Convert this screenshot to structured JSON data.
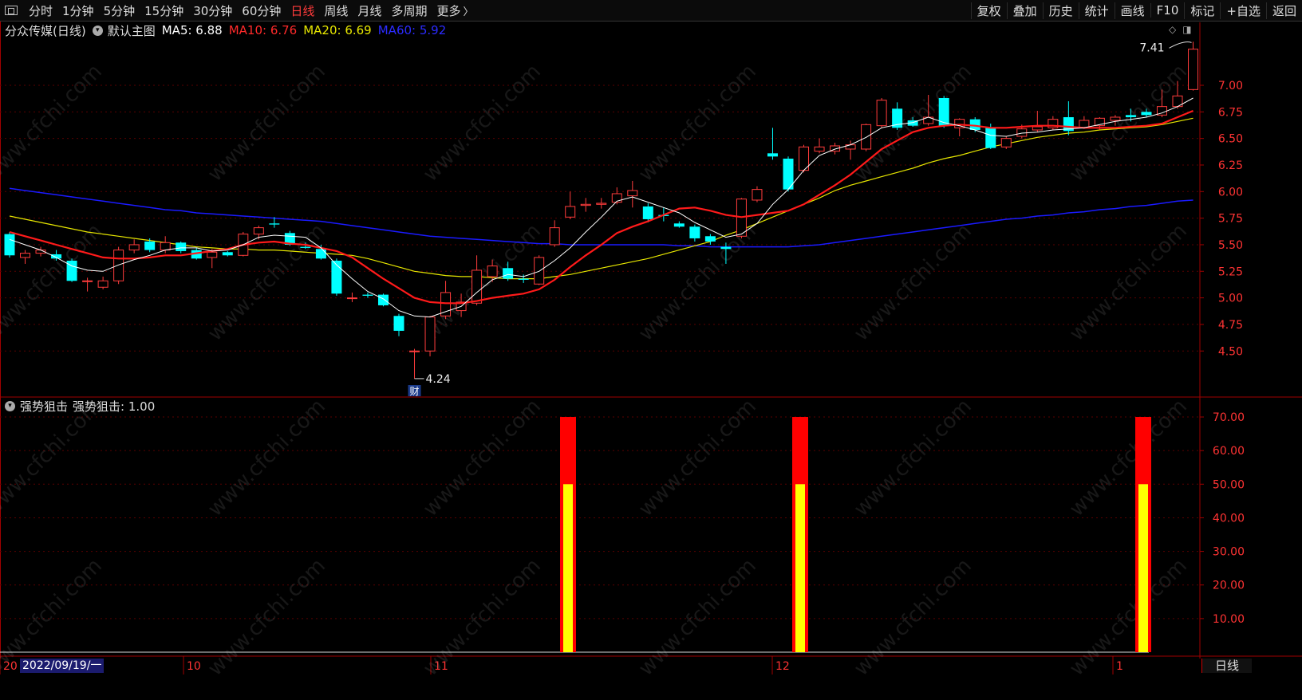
{
  "toolbar": {
    "left_items": [
      {
        "label": "分时",
        "active": false
      },
      {
        "label": "1分钟",
        "active": false
      },
      {
        "label": "5分钟",
        "active": false
      },
      {
        "label": "15分钟",
        "active": false
      },
      {
        "label": "30分钟",
        "active": false
      },
      {
        "label": "60分钟",
        "active": false
      },
      {
        "label": "日线",
        "active": true
      },
      {
        "label": "周线",
        "active": false
      },
      {
        "label": "月线",
        "active": false
      },
      {
        "label": "多周期",
        "active": false
      },
      {
        "label": "更多",
        "active": false
      }
    ],
    "more_chevron": "〉",
    "right_items": [
      "复权",
      "叠加",
      "历史",
      "统计",
      "画线",
      "F10",
      "标记",
      "+自选",
      "返回"
    ]
  },
  "main_legend": {
    "stock": "分众传媒(日线)",
    "template": "默认主图",
    "ma5": "MA5: 6.88",
    "ma10": "MA10: 6.76",
    "ma20": "MA20: 6.69",
    "ma60": "MA60: 5.92"
  },
  "sub_legend": {
    "name": "强势狙击",
    "value": "强势狙击: 1.00"
  },
  "annotations": {
    "high": "7.41",
    "low": "4.24",
    "finance_tag": "财"
  },
  "x_axis": {
    "date_badge": "2022/09/19/一",
    "month_labels": [
      "20",
      "10",
      "11",
      "12",
      "1"
    ]
  },
  "period_badge": "日线",
  "colors": {
    "up": "#ff3c3c",
    "down": "#00ffff",
    "ma5": "#ffffff",
    "ma10": "#ff1a1a",
    "ma20": "#e6e600",
    "ma60": "#1a1aff",
    "grid": "#8b0000",
    "axis_text": "#ff3333"
  },
  "chart_data": [
    {
      "type": "candlestick",
      "title": "分众传媒(日线)",
      "y_range": [
        4.24,
        7.41
      ],
      "y_ticks": [
        "7.00",
        "6.75",
        "6.50",
        "6.25",
        "6.00",
        "5.75",
        "5.50",
        "5.25",
        "5.00",
        "4.75",
        "4.50"
      ],
      "candles": [
        {
          "o": 5.6,
          "h": 5.62,
          "l": 5.38,
          "c": 5.4
        },
        {
          "o": 5.38,
          "h": 5.45,
          "l": 5.32,
          "c": 5.42
        },
        {
          "o": 5.42,
          "h": 5.48,
          "l": 5.39,
          "c": 5.45
        },
        {
          "o": 5.41,
          "h": 5.45,
          "l": 5.35,
          "c": 5.37
        },
        {
          "o": 5.35,
          "h": 5.37,
          "l": 5.15,
          "c": 5.16
        },
        {
          "o": 5.16,
          "h": 5.19,
          "l": 5.06,
          "c": 5.16
        },
        {
          "o": 5.1,
          "h": 5.2,
          "l": 5.08,
          "c": 5.16
        },
        {
          "o": 5.16,
          "h": 5.48,
          "l": 5.13,
          "c": 5.45
        },
        {
          "o": 5.45,
          "h": 5.55,
          "l": 5.42,
          "c": 5.5
        },
        {
          "o": 5.53,
          "h": 5.56,
          "l": 5.43,
          "c": 5.45
        },
        {
          "o": 5.45,
          "h": 5.58,
          "l": 5.42,
          "c": 5.52
        },
        {
          "o": 5.52,
          "h": 5.53,
          "l": 5.42,
          "c": 5.44
        },
        {
          "o": 5.45,
          "h": 5.47,
          "l": 5.36,
          "c": 5.37
        },
        {
          "o": 5.38,
          "h": 5.46,
          "l": 5.28,
          "c": 5.43
        },
        {
          "o": 5.43,
          "h": 5.44,
          "l": 5.39,
          "c": 5.4
        },
        {
          "o": 5.4,
          "h": 5.62,
          "l": 5.39,
          "c": 5.6
        },
        {
          "o": 5.6,
          "h": 5.68,
          "l": 5.55,
          "c": 5.66
        },
        {
          "o": 5.7,
          "h": 5.76,
          "l": 5.66,
          "c": 5.69
        },
        {
          "o": 5.61,
          "h": 5.63,
          "l": 5.49,
          "c": 5.5
        },
        {
          "o": 5.48,
          "h": 5.52,
          "l": 5.46,
          "c": 5.47
        },
        {
          "o": 5.46,
          "h": 5.5,
          "l": 5.36,
          "c": 5.37
        },
        {
          "o": 5.35,
          "h": 5.37,
          "l": 5.02,
          "c": 5.04
        },
        {
          "o": 5.0,
          "h": 5.05,
          "l": 4.96,
          "c": 5.0
        },
        {
          "o": 5.03,
          "h": 5.05,
          "l": 5.0,
          "c": 5.02
        },
        {
          "o": 5.03,
          "h": 5.04,
          "l": 4.92,
          "c": 4.93
        },
        {
          "o": 4.83,
          "h": 4.85,
          "l": 4.64,
          "c": 4.69
        },
        {
          "o": 4.5,
          "h": 4.52,
          "l": 4.24,
          "c": 4.5
        },
        {
          "o": 4.5,
          "h": 4.83,
          "l": 4.45,
          "c": 4.82
        },
        {
          "o": 4.83,
          "h": 5.16,
          "l": 4.8,
          "c": 5.05
        },
        {
          "o": 4.88,
          "h": 5.04,
          "l": 4.82,
          "c": 4.96
        },
        {
          "o": 4.95,
          "h": 5.4,
          "l": 4.93,
          "c": 5.26
        },
        {
          "o": 5.2,
          "h": 5.36,
          "l": 5.15,
          "c": 5.3
        },
        {
          "o": 5.28,
          "h": 5.34,
          "l": 5.16,
          "c": 5.18
        },
        {
          "o": 5.18,
          "h": 5.22,
          "l": 5.14,
          "c": 5.17
        },
        {
          "o": 5.13,
          "h": 5.4,
          "l": 5.12,
          "c": 5.38
        },
        {
          "o": 5.5,
          "h": 5.73,
          "l": 5.48,
          "c": 5.66
        },
        {
          "o": 5.76,
          "h": 6.0,
          "l": 5.74,
          "c": 5.86
        },
        {
          "o": 5.87,
          "h": 5.94,
          "l": 5.81,
          "c": 5.88
        },
        {
          "o": 5.88,
          "h": 5.94,
          "l": 5.84,
          "c": 5.89
        },
        {
          "o": 5.9,
          "h": 6.04,
          "l": 5.88,
          "c": 5.98
        },
        {
          "o": 5.96,
          "h": 6.1,
          "l": 5.85,
          "c": 6.01
        },
        {
          "o": 5.86,
          "h": 5.89,
          "l": 5.71,
          "c": 5.74
        },
        {
          "o": 5.78,
          "h": 5.85,
          "l": 5.72,
          "c": 5.77
        },
        {
          "o": 5.7,
          "h": 5.72,
          "l": 5.66,
          "c": 5.67
        },
        {
          "o": 5.67,
          "h": 5.69,
          "l": 5.53,
          "c": 5.56
        },
        {
          "o": 5.58,
          "h": 5.6,
          "l": 5.5,
          "c": 5.53
        },
        {
          "o": 5.48,
          "h": 5.52,
          "l": 5.32,
          "c": 5.46
        },
        {
          "o": 5.58,
          "h": 5.94,
          "l": 5.56,
          "c": 5.93
        },
        {
          "o": 5.92,
          "h": 6.05,
          "l": 5.9,
          "c": 6.02
        },
        {
          "o": 6.36,
          "h": 6.6,
          "l": 6.3,
          "c": 6.33
        },
        {
          "o": 6.31,
          "h": 6.33,
          "l": 6.0,
          "c": 6.02
        },
        {
          "o": 6.2,
          "h": 6.44,
          "l": 6.18,
          "c": 6.42
        },
        {
          "o": 6.38,
          "h": 6.5,
          "l": 6.36,
          "c": 6.42
        },
        {
          "o": 6.38,
          "h": 6.46,
          "l": 6.35,
          "c": 6.43
        },
        {
          "o": 6.4,
          "h": 6.48,
          "l": 6.3,
          "c": 6.44
        },
        {
          "o": 6.4,
          "h": 6.64,
          "l": 6.38,
          "c": 6.63
        },
        {
          "o": 6.62,
          "h": 6.88,
          "l": 6.6,
          "c": 6.86
        },
        {
          "o": 6.78,
          "h": 6.84,
          "l": 6.58,
          "c": 6.6
        },
        {
          "o": 6.67,
          "h": 6.7,
          "l": 6.61,
          "c": 6.62
        },
        {
          "o": 6.64,
          "h": 6.91,
          "l": 6.62,
          "c": 6.7
        },
        {
          "o": 6.88,
          "h": 6.9,
          "l": 6.6,
          "c": 6.62
        },
        {
          "o": 6.6,
          "h": 6.69,
          "l": 6.52,
          "c": 6.68
        },
        {
          "o": 6.68,
          "h": 6.7,
          "l": 6.56,
          "c": 6.58
        },
        {
          "o": 6.6,
          "h": 6.64,
          "l": 6.4,
          "c": 6.41
        },
        {
          "o": 6.42,
          "h": 6.52,
          "l": 6.4,
          "c": 6.5
        },
        {
          "o": 6.52,
          "h": 6.63,
          "l": 6.5,
          "c": 6.59
        },
        {
          "o": 6.58,
          "h": 6.76,
          "l": 6.56,
          "c": 6.61
        },
        {
          "o": 6.6,
          "h": 6.71,
          "l": 6.58,
          "c": 6.68
        },
        {
          "o": 6.7,
          "h": 6.85,
          "l": 6.53,
          "c": 6.57
        },
        {
          "o": 6.6,
          "h": 6.71,
          "l": 6.59,
          "c": 6.67
        },
        {
          "o": 6.62,
          "h": 6.7,
          "l": 6.58,
          "c": 6.69
        },
        {
          "o": 6.67,
          "h": 6.72,
          "l": 6.62,
          "c": 6.7
        },
        {
          "o": 6.72,
          "h": 6.78,
          "l": 6.66,
          "c": 6.7
        },
        {
          "o": 6.75,
          "h": 6.78,
          "l": 6.7,
          "c": 6.72
        },
        {
          "o": 6.72,
          "h": 6.96,
          "l": 6.7,
          "c": 6.8
        },
        {
          "o": 6.8,
          "h": 7.04,
          "l": 6.78,
          "c": 6.9
        },
        {
          "o": 6.96,
          "h": 7.41,
          "l": 6.95,
          "c": 7.34
        }
      ],
      "ma5": [
        5.55,
        5.5,
        5.45,
        5.38,
        5.3,
        5.26,
        5.25,
        5.31,
        5.36,
        5.4,
        5.45,
        5.47,
        5.47,
        5.44,
        5.45,
        5.5,
        5.57,
        5.59,
        5.58,
        5.57,
        5.47,
        5.31,
        5.18,
        5.06,
        4.99,
        4.88,
        4.83,
        4.82,
        4.87,
        4.92,
        5.05,
        5.17,
        5.22,
        5.2,
        5.25,
        5.35,
        5.47,
        5.62,
        5.76,
        5.91,
        5.95,
        5.9,
        5.85,
        5.8,
        5.71,
        5.64,
        5.57,
        5.6,
        5.7,
        5.88,
        6.02,
        6.2,
        6.34,
        6.4,
        6.44,
        6.51,
        6.6,
        6.63,
        6.65,
        6.7,
        6.65,
        6.62,
        6.58,
        6.53,
        6.52,
        6.55,
        6.56,
        6.58,
        6.59,
        6.6,
        6.63,
        6.66,
        6.68,
        6.7,
        6.74,
        6.8,
        6.88
      ],
      "ma10": [
        5.62,
        5.58,
        5.54,
        5.5,
        5.46,
        5.42,
        5.38,
        5.37,
        5.37,
        5.38,
        5.4,
        5.4,
        5.42,
        5.44,
        5.46,
        5.5,
        5.52,
        5.53,
        5.51,
        5.5,
        5.47,
        5.44,
        5.38,
        5.28,
        5.18,
        5.09,
        5.0,
        4.96,
        4.95,
        4.95,
        4.97,
        5.0,
        5.02,
        5.04,
        5.08,
        5.17,
        5.29,
        5.4,
        5.5,
        5.61,
        5.67,
        5.72,
        5.78,
        5.84,
        5.85,
        5.82,
        5.78,
        5.76,
        5.78,
        5.8,
        5.82,
        5.88,
        5.97,
        6.06,
        6.16,
        6.28,
        6.4,
        6.48,
        6.56,
        6.6,
        6.62,
        6.63,
        6.62,
        6.6,
        6.6,
        6.61,
        6.62,
        6.62,
        6.61,
        6.6,
        6.6,
        6.6,
        6.61,
        6.62,
        6.64,
        6.7,
        6.76
      ],
      "ma20": [
        5.77,
        5.74,
        5.71,
        5.68,
        5.65,
        5.62,
        5.6,
        5.58,
        5.56,
        5.54,
        5.52,
        5.5,
        5.48,
        5.47,
        5.46,
        5.46,
        5.45,
        5.45,
        5.44,
        5.43,
        5.42,
        5.41,
        5.4,
        5.37,
        5.33,
        5.29,
        5.25,
        5.23,
        5.21,
        5.2,
        5.2,
        5.19,
        5.18,
        5.18,
        5.18,
        5.2,
        5.22,
        5.25,
        5.28,
        5.31,
        5.34,
        5.37,
        5.41,
        5.45,
        5.49,
        5.53,
        5.59,
        5.64,
        5.7,
        5.76,
        5.82,
        5.88,
        5.94,
        6.01,
        6.06,
        6.1,
        6.14,
        6.18,
        6.22,
        6.27,
        6.31,
        6.34,
        6.38,
        6.42,
        6.45,
        6.48,
        6.51,
        6.53,
        6.55,
        6.56,
        6.58,
        6.59,
        6.6,
        6.61,
        6.63,
        6.66,
        6.69
      ],
      "ma60": [
        6.03,
        6.01,
        5.99,
        5.97,
        5.95,
        5.93,
        5.91,
        5.89,
        5.87,
        5.85,
        5.83,
        5.82,
        5.8,
        5.79,
        5.78,
        5.77,
        5.76,
        5.75,
        5.74,
        5.73,
        5.72,
        5.7,
        5.68,
        5.66,
        5.64,
        5.62,
        5.6,
        5.58,
        5.57,
        5.56,
        5.55,
        5.54,
        5.53,
        5.52,
        5.51,
        5.51,
        5.5,
        5.5,
        5.5,
        5.5,
        5.5,
        5.5,
        5.5,
        5.49,
        5.49,
        5.48,
        5.48,
        5.48,
        5.48,
        5.48,
        5.48,
        5.49,
        5.5,
        5.52,
        5.54,
        5.56,
        5.58,
        5.6,
        5.62,
        5.64,
        5.66,
        5.68,
        5.7,
        5.72,
        5.74,
        5.75,
        5.77,
        5.78,
        5.8,
        5.81,
        5.83,
        5.84,
        5.86,
        5.87,
        5.89,
        5.91,
        5.92
      ]
    },
    {
      "type": "bar",
      "title": "强势狙击",
      "y_range": [
        0,
        70
      ],
      "y_ticks": [
        "70.00",
        "60.00",
        "50.00",
        "40.00",
        "30.00",
        "20.00",
        "10.00"
      ],
      "signals": [
        {
          "bar_index": 35,
          "outer": 70,
          "inner": 50
        },
        {
          "bar_index": 50,
          "outer": 70,
          "inner": 50
        },
        {
          "bar_index": 76,
          "outer": 70,
          "inner": 50
        }
      ]
    }
  ]
}
